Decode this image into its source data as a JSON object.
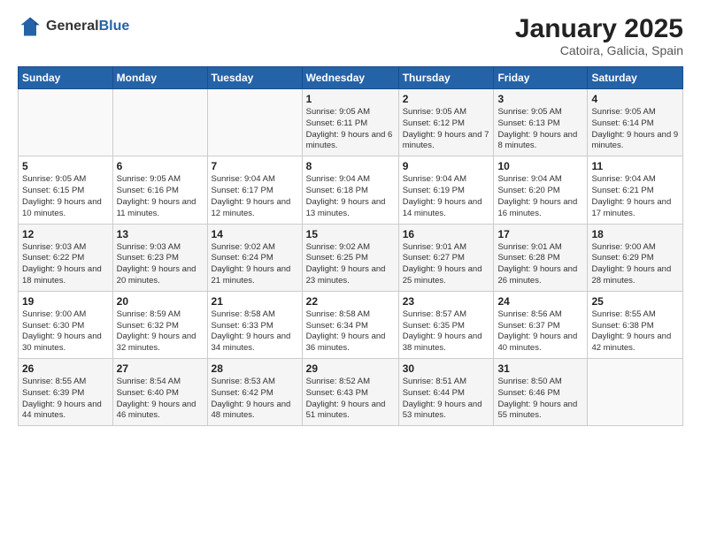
{
  "header": {
    "logo_general": "General",
    "logo_blue": "Blue",
    "month_title": "January 2025",
    "location": "Catoira, Galicia, Spain"
  },
  "weekdays": [
    "Sunday",
    "Monday",
    "Tuesday",
    "Wednesday",
    "Thursday",
    "Friday",
    "Saturday"
  ],
  "weeks": [
    [
      {
        "day": "",
        "info": ""
      },
      {
        "day": "",
        "info": ""
      },
      {
        "day": "",
        "info": ""
      },
      {
        "day": "1",
        "info": "Sunrise: 9:05 AM\nSunset: 6:11 PM\nDaylight: 9 hours and 6 minutes."
      },
      {
        "day": "2",
        "info": "Sunrise: 9:05 AM\nSunset: 6:12 PM\nDaylight: 9 hours and 7 minutes."
      },
      {
        "day": "3",
        "info": "Sunrise: 9:05 AM\nSunset: 6:13 PM\nDaylight: 9 hours and 8 minutes."
      },
      {
        "day": "4",
        "info": "Sunrise: 9:05 AM\nSunset: 6:14 PM\nDaylight: 9 hours and 9 minutes."
      }
    ],
    [
      {
        "day": "5",
        "info": "Sunrise: 9:05 AM\nSunset: 6:15 PM\nDaylight: 9 hours and 10 minutes."
      },
      {
        "day": "6",
        "info": "Sunrise: 9:05 AM\nSunset: 6:16 PM\nDaylight: 9 hours and 11 minutes."
      },
      {
        "day": "7",
        "info": "Sunrise: 9:04 AM\nSunset: 6:17 PM\nDaylight: 9 hours and 12 minutes."
      },
      {
        "day": "8",
        "info": "Sunrise: 9:04 AM\nSunset: 6:18 PM\nDaylight: 9 hours and 13 minutes."
      },
      {
        "day": "9",
        "info": "Sunrise: 9:04 AM\nSunset: 6:19 PM\nDaylight: 9 hours and 14 minutes."
      },
      {
        "day": "10",
        "info": "Sunrise: 9:04 AM\nSunset: 6:20 PM\nDaylight: 9 hours and 16 minutes."
      },
      {
        "day": "11",
        "info": "Sunrise: 9:04 AM\nSunset: 6:21 PM\nDaylight: 9 hours and 17 minutes."
      }
    ],
    [
      {
        "day": "12",
        "info": "Sunrise: 9:03 AM\nSunset: 6:22 PM\nDaylight: 9 hours and 18 minutes."
      },
      {
        "day": "13",
        "info": "Sunrise: 9:03 AM\nSunset: 6:23 PM\nDaylight: 9 hours and 20 minutes."
      },
      {
        "day": "14",
        "info": "Sunrise: 9:02 AM\nSunset: 6:24 PM\nDaylight: 9 hours and 21 minutes."
      },
      {
        "day": "15",
        "info": "Sunrise: 9:02 AM\nSunset: 6:25 PM\nDaylight: 9 hours and 23 minutes."
      },
      {
        "day": "16",
        "info": "Sunrise: 9:01 AM\nSunset: 6:27 PM\nDaylight: 9 hours and 25 minutes."
      },
      {
        "day": "17",
        "info": "Sunrise: 9:01 AM\nSunset: 6:28 PM\nDaylight: 9 hours and 26 minutes."
      },
      {
        "day": "18",
        "info": "Sunrise: 9:00 AM\nSunset: 6:29 PM\nDaylight: 9 hours and 28 minutes."
      }
    ],
    [
      {
        "day": "19",
        "info": "Sunrise: 9:00 AM\nSunset: 6:30 PM\nDaylight: 9 hours and 30 minutes."
      },
      {
        "day": "20",
        "info": "Sunrise: 8:59 AM\nSunset: 6:32 PM\nDaylight: 9 hours and 32 minutes."
      },
      {
        "day": "21",
        "info": "Sunrise: 8:58 AM\nSunset: 6:33 PM\nDaylight: 9 hours and 34 minutes."
      },
      {
        "day": "22",
        "info": "Sunrise: 8:58 AM\nSunset: 6:34 PM\nDaylight: 9 hours and 36 minutes."
      },
      {
        "day": "23",
        "info": "Sunrise: 8:57 AM\nSunset: 6:35 PM\nDaylight: 9 hours and 38 minutes."
      },
      {
        "day": "24",
        "info": "Sunrise: 8:56 AM\nSunset: 6:37 PM\nDaylight: 9 hours and 40 minutes."
      },
      {
        "day": "25",
        "info": "Sunrise: 8:55 AM\nSunset: 6:38 PM\nDaylight: 9 hours and 42 minutes."
      }
    ],
    [
      {
        "day": "26",
        "info": "Sunrise: 8:55 AM\nSunset: 6:39 PM\nDaylight: 9 hours and 44 minutes."
      },
      {
        "day": "27",
        "info": "Sunrise: 8:54 AM\nSunset: 6:40 PM\nDaylight: 9 hours and 46 minutes."
      },
      {
        "day": "28",
        "info": "Sunrise: 8:53 AM\nSunset: 6:42 PM\nDaylight: 9 hours and 48 minutes."
      },
      {
        "day": "29",
        "info": "Sunrise: 8:52 AM\nSunset: 6:43 PM\nDaylight: 9 hours and 51 minutes."
      },
      {
        "day": "30",
        "info": "Sunrise: 8:51 AM\nSunset: 6:44 PM\nDaylight: 9 hours and 53 minutes."
      },
      {
        "day": "31",
        "info": "Sunrise: 8:50 AM\nSunset: 6:46 PM\nDaylight: 9 hours and 55 minutes."
      },
      {
        "day": "",
        "info": ""
      }
    ]
  ]
}
